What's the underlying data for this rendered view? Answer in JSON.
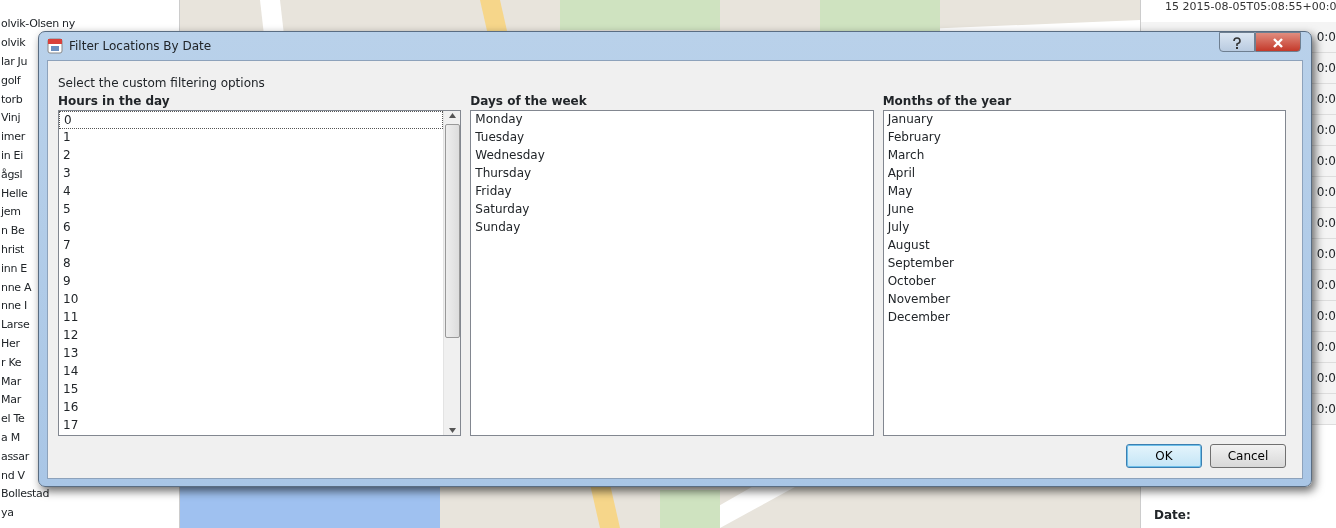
{
  "background_list": {
    "items": [
      "olvik-Olsen ny",
      "olvik",
      "lar Ju",
      "golf",
      "torb",
      "Vinj",
      "imer",
      "in Ei",
      "ågsl",
      "Helle",
      "jem",
      "n Be",
      "hrist",
      "inn E",
      "nne A",
      "nne I",
      "Larse",
      "Her",
      "r Ke",
      "Mar",
      "Mar",
      "el Te",
      "a M",
      "assar",
      "nd V",
      "Bollestad",
      "ya"
    ]
  },
  "background_table": {
    "header": "15  2015-08-05T05:08:55+00:0",
    "rows": [
      "0:0",
      "0:0",
      "0:0",
      "0:0",
      "0:0",
      "0:0",
      "0:0",
      "0:0",
      "0:0",
      "0:0",
      "0:0",
      "0:0",
      "0:0"
    ],
    "date_label": "Date:"
  },
  "dialog": {
    "title": "Filter Locations By Date",
    "instruction": "Select the custom filtering options",
    "lists": [
      {
        "heading": "Hours in the day",
        "scrollable": true,
        "items": [
          {
            "label": "0",
            "focused": true
          },
          {
            "label": "1",
            "focused": false
          },
          {
            "label": "2",
            "focused": false
          },
          {
            "label": "3",
            "focused": false
          },
          {
            "label": "4",
            "focused": false
          },
          {
            "label": "5",
            "focused": false
          },
          {
            "label": "6",
            "focused": false
          },
          {
            "label": "7",
            "focused": false
          },
          {
            "label": "8",
            "focused": false
          },
          {
            "label": "9",
            "focused": false
          },
          {
            "label": "10",
            "focused": false
          },
          {
            "label": "11",
            "focused": false
          },
          {
            "label": "12",
            "focused": false
          },
          {
            "label": "13",
            "focused": false
          },
          {
            "label": "14",
            "focused": false
          },
          {
            "label": "15",
            "focused": false
          },
          {
            "label": "16",
            "focused": false
          },
          {
            "label": "17",
            "focused": false
          }
        ]
      },
      {
        "heading": "Days of the week",
        "scrollable": false,
        "items": [
          {
            "label": "Monday",
            "focused": false
          },
          {
            "label": "Tuesday",
            "focused": false
          },
          {
            "label": "Wednesday",
            "focused": false
          },
          {
            "label": "Thursday",
            "focused": false
          },
          {
            "label": "Friday",
            "focused": false
          },
          {
            "label": "Saturday",
            "focused": false
          },
          {
            "label": "Sunday",
            "focused": false
          }
        ]
      },
      {
        "heading": "Months of the year",
        "scrollable": false,
        "items": [
          {
            "label": "January",
            "focused": false
          },
          {
            "label": "February",
            "focused": false
          },
          {
            "label": "March",
            "focused": false
          },
          {
            "label": "April",
            "focused": false
          },
          {
            "label": "May",
            "focused": false
          },
          {
            "label": "June",
            "focused": false
          },
          {
            "label": "July",
            "focused": false
          },
          {
            "label": "August",
            "focused": false
          },
          {
            "label": "September",
            "focused": false
          },
          {
            "label": "October",
            "focused": false
          },
          {
            "label": "November",
            "focused": false
          },
          {
            "label": "December",
            "focused": false
          }
        ]
      }
    ],
    "buttons": [
      {
        "label": "OK",
        "default": true
      },
      {
        "label": "Cancel",
        "default": false
      }
    ]
  }
}
